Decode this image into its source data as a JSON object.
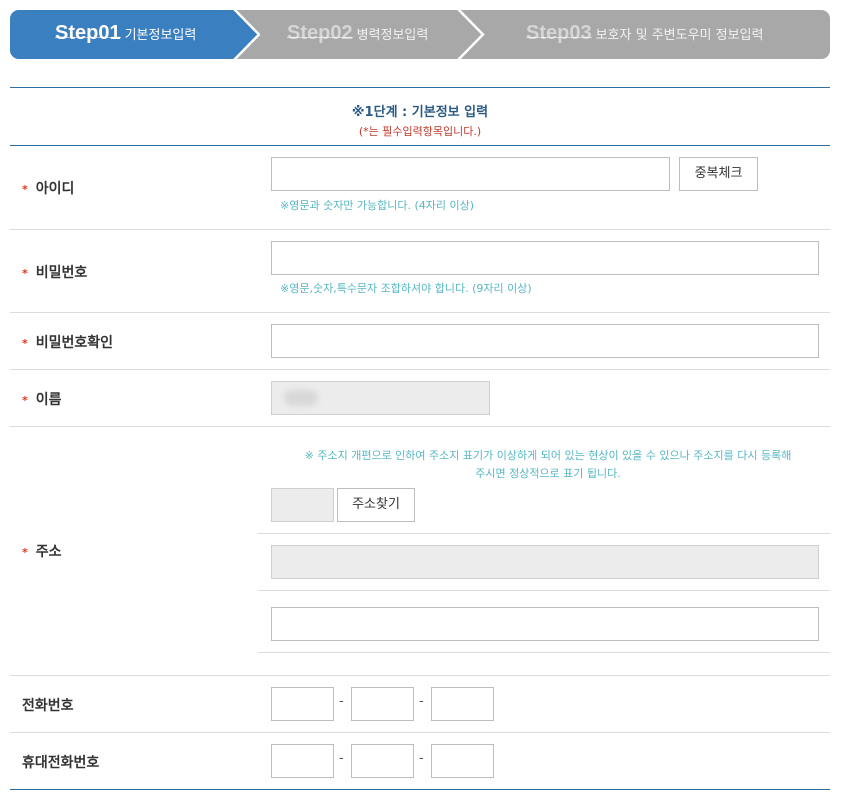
{
  "steps": [
    {
      "num": "Step01",
      "label": "기본정보입력",
      "active": true
    },
    {
      "num": "Step02",
      "label": "병력정보입력",
      "active": false
    },
    {
      "num": "Step03",
      "label": "보호자 및 주변도우미 정보입력",
      "active": false
    }
  ],
  "colors": {
    "active_step": "#3a7fc0",
    "inactive_step": "#a8a8a8",
    "border_accent": "#2f6e9e",
    "hint": "#57b7c4",
    "required": "#d9381e"
  },
  "header": {
    "title": "※1단계 : 기본정보 입력",
    "note": "(*는 필수입력항목입니다.)"
  },
  "required_mark": "*",
  "fields": {
    "id": {
      "label": "아이디",
      "value": "",
      "button": "중복체크",
      "hint": "※영문과 숫자만 가능합니다. (4자리 이상)"
    },
    "password": {
      "label": "비밀번호",
      "value": "",
      "hint": "※영문,숫자,특수문자 조합하셔야 합니다. (9자리 이상)"
    },
    "password_confirm": {
      "label": "비밀번호확인",
      "value": ""
    },
    "name": {
      "label": "이름",
      "value": ""
    },
    "address": {
      "label": "주소",
      "notice_line1": "※ 주소지 개편으로 인하여 주소지 표기가 이상하게 되어 있는 현상이 있을 수 있으나 주소지를 다시 등록해",
      "notice_line2": "주시면 정상적으로 표기 됩니다.",
      "zipcode": "",
      "search_button": "주소찾기",
      "address1": "",
      "address2": ""
    },
    "phone": {
      "label": "전화번호",
      "part1": "",
      "part2": "",
      "part3": "",
      "separator": "-"
    },
    "mobile": {
      "label": "휴대전화번호",
      "part1": "",
      "part2": "",
      "part3": "",
      "separator": "-"
    }
  }
}
